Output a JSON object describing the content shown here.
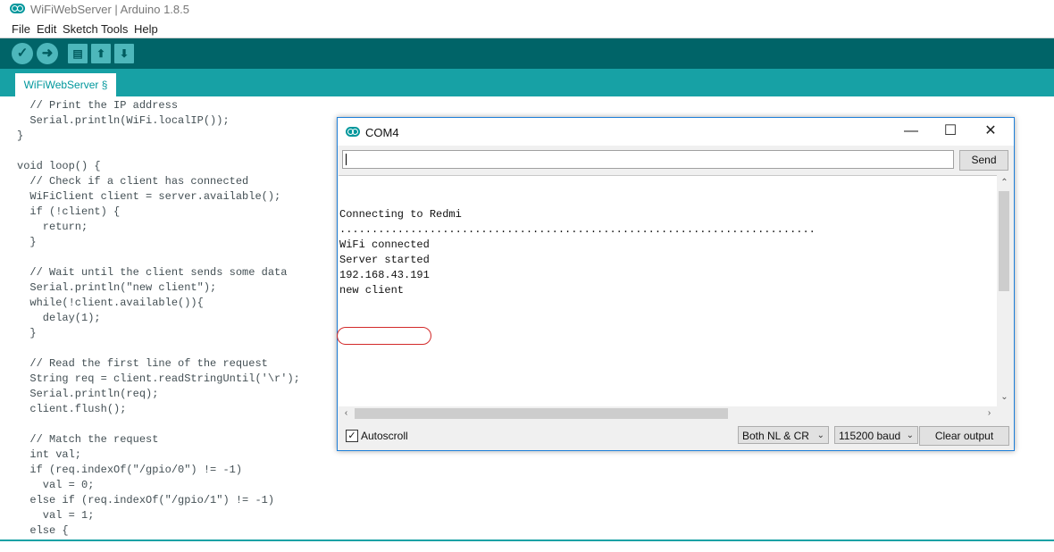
{
  "window": {
    "title": "WiFiWebServer | Arduino 1.8.5"
  },
  "menu": [
    "File",
    "Edit",
    "Sketch",
    "Tools",
    "Help"
  ],
  "toolbar": {
    "verify_icon": "check-icon",
    "upload_icon": "arrow-right-icon",
    "new_icon": "new-file-icon",
    "open_icon": "open-arrow-up-icon",
    "save_icon": "save-arrow-down-icon"
  },
  "tab": {
    "label": "WiFiWebServer §"
  },
  "code": [
    "  // Print the IP address",
    "  Serial.println(WiFi.localIP());",
    "}",
    "",
    "void loop() {",
    "  // Check if a client has connected",
    "  WiFiClient client = server.available();",
    "  if (!client) {",
    "    return;",
    "  }",
    "",
    "  // Wait until the client sends some data",
    "  Serial.println(\"new client\");",
    "  while(!client.available()){",
    "    delay(1);",
    "  }",
    "",
    "  // Read the first line of the request",
    "  String req = client.readStringUntil('\\r');",
    "  Serial.println(req);",
    "  client.flush();",
    "",
    "  // Match the request",
    "  int val;",
    "  if (req.indexOf(\"/gpio/0\") != -1)",
    "    val = 0;",
    "  else if (req.indexOf(\"/gpio/1\") != -1)",
    "    val = 1;",
    "  else {"
  ],
  "serial": {
    "title": "COM4",
    "minimize": "—",
    "maximize": "☐",
    "close": "✕",
    "send_label": "Send",
    "input_value": "",
    "output": [
      "",
      "",
      "Connecting to Redmi",
      "..........................................................................",
      "WiFi connected",
      "Server started",
      "192.168.43.191",
      "new client"
    ],
    "autoscroll_label": "Autoscroll",
    "autoscroll_checked": true,
    "line_ending": "Both NL & CR",
    "baud": "115200 baud",
    "clear_label": "Clear output"
  },
  "colors": {
    "toolbar": "#006468",
    "tabstrip": "#17a1a5",
    "accent": "#00979c",
    "annotation": "#d32a2a"
  }
}
